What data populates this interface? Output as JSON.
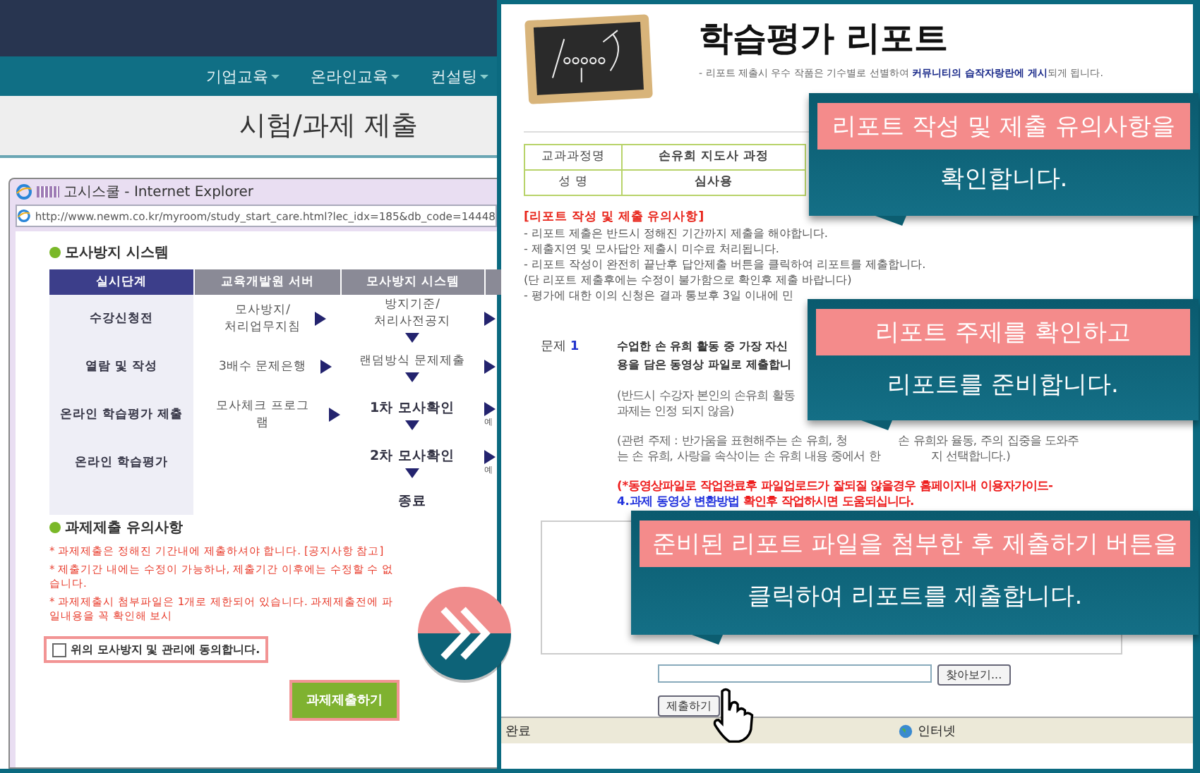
{
  "left_page": {
    "nav": [
      "기업교육",
      "온라인교육",
      "컨설팅"
    ],
    "title": "시험/과제 제출",
    "popup": {
      "title": "고시스쿨 - Internet Explorer",
      "address": "http://www.newm.co.kr/myroom/study_start_care.html?lec_idx=185&db_code=14448",
      "section_title": "모사방지 시스템",
      "columns": [
        "실시단계",
        "교육개발원 서버",
        "모사방지 시스템"
      ],
      "rows": [
        {
          "stage": "수강신청전",
          "server": "모사방지/\n처리업무지침",
          "system": "방지기준/\n처리사전공지",
          "note": ""
        },
        {
          "stage": "열람 및 작성",
          "server": "3배수 문제은행",
          "system": "랜덤방식 문제제출",
          "note": ""
        },
        {
          "stage": "온라인 학습평가 제출",
          "server": "모사체크 프로그램",
          "system": "1차 모사확인",
          "note": "예"
        },
        {
          "stage": "온라인 학습평가",
          "server": "",
          "system": "2차 모사확인",
          "note": "예"
        }
      ],
      "end": "종료",
      "notice_title": "과제제출 유의사항",
      "notices": [
        "* 과제제출은 정해진 기간내에 제출하셔야 합니다. [공지사항 참고]",
        "* 제출기간 내에는 수정이 가능하나, 제출기간 이후에는 수정할 수 없습니다.",
        "* 과제제출시 첨부파일은 1개로 제한되어 있습니다. 과제제출전에 파일내용을 꼭 확인해 보시"
      ],
      "agree": {
        "label": "위의 모사방지 및 관리에 동의합니다.",
        "checked": false
      },
      "submit": "과제제출하기"
    }
  },
  "right_page": {
    "title": "학습평가 리포트",
    "subtitle": "- 리포트 제출시 우수 작품은 기수별로 선별하여 **커뮤니티의 습작자랑란에 게시**되게 됩니다.",
    "info": [
      {
        "label": "교과과정명",
        "value": "손유희 지도사 과정"
      },
      {
        "label": "성 명",
        "value": "심사용"
      }
    ],
    "notes_title": "[리포트 작성 및 제출 유의사항]",
    "notes": [
      "- 리포트 제출은 반드시 정해진 기간까지 제출을 해야합니다.",
      "- 제출지연 및 모사답안 제출시 미수료 처리됩니다.",
      "- 리포트 작성이 완전히 끝난후 답안제출 버튼을 클릭하여 리포트를 제출합니다.",
      "(단 리포트 제출후에는 수정이 불가함으로 확인후 제출 바랍니다)",
      "- 평가에 대한 이의 신청은 결과 통보후 3일 이내에 민"
    ],
    "question": {
      "label": "문제",
      "number": "1",
      "lines": [
        "수업한 손 유희 활동 중 가장 자신",
        "용을 담은 **동영상 파일로 제출합니**"
      ],
      "remark": [
        "(반드시 수강자 본인의  손유희 활동",
        "과제는  인정 되지 않음)"
      ],
      "topic": [
        [
          "(관련 주제 : 반가움을 표현해주는 손 유희, 청",
          "손 유희와 율동, 주의 집중을 도와주"
        ],
        [
          "는 손 유희, 사랑을 속삭이는 손 유희 내용 중에서 한",
          "지 선택합니다.)"
        ]
      ],
      "warning": "(*동영상파일로 작업완료후 파일업로드가 잘되질 않을경우 홈페이지내 이용자가이드-",
      "guide_link": "4.과제 동영상 변환방법",
      "warning_end": "확인후 작업하시면 도움되십니다."
    },
    "browse": "찾아보기...",
    "submit": "제출하기",
    "status": "완료",
    "zone": "인터넷"
  },
  "callouts": [
    {
      "highlight": "리포트 작성 및 제출 유의사항을",
      "text": "확인합니다."
    },
    {
      "highlight": "리포트 주제를 확인하고",
      "text": "리포트를 준비합니다."
    },
    {
      "highlight": "준비된 리포트 파일을 첨부한 후 제출하기 버튼을",
      "text": "클릭하여 리포트를 제출합니다."
    }
  ]
}
